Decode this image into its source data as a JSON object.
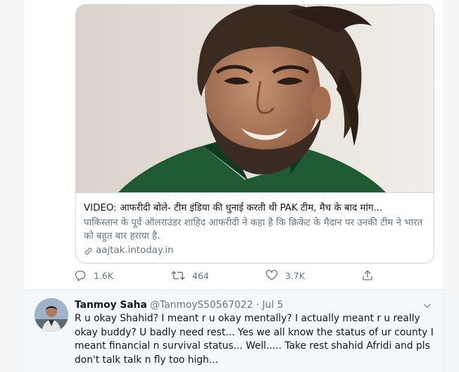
{
  "card": {
    "title": "VIDEO: आफरीदी बोले- टीम इंडिया की धुनाई करती थी PAK टीम, मैच के बाद मांग...",
    "description": "पाकिस्तान के पूर्व ऑलराउंडर शाहिद आफरीदी ने कहा है कि क्रिकेट के मैदान पर उनकी टीम ने भारत को बहुत बार हराया है.",
    "domain": "aajtak.intoday.in"
  },
  "actions": {
    "reply_count": "1.6K",
    "retweet_count": "464",
    "like_count": "3.7K"
  },
  "reply": {
    "name": "Tanmoy Saha",
    "handle": "@TanmoyS50567022",
    "separator": "·",
    "time": "Jul 5",
    "text": "R u okay Shahid? I meant r u okay mentally? I actually meant r u really okay buddy? U badly need rest... Yes we all know the status of ur county I meant financial n survival status... Well..... Take rest shahid Afridi and pls don't talk talk n fly too high..."
  },
  "colors": {
    "text_primary": "#14171a",
    "text_secondary": "#657786",
    "border": "#ccd6dd",
    "reply_bg": "#f5f8fa",
    "jersey_green": "#1f5a32"
  },
  "icons": [
    "reply-icon",
    "retweet-icon",
    "like-icon",
    "share-icon",
    "link-icon",
    "chevron-down-icon"
  ]
}
